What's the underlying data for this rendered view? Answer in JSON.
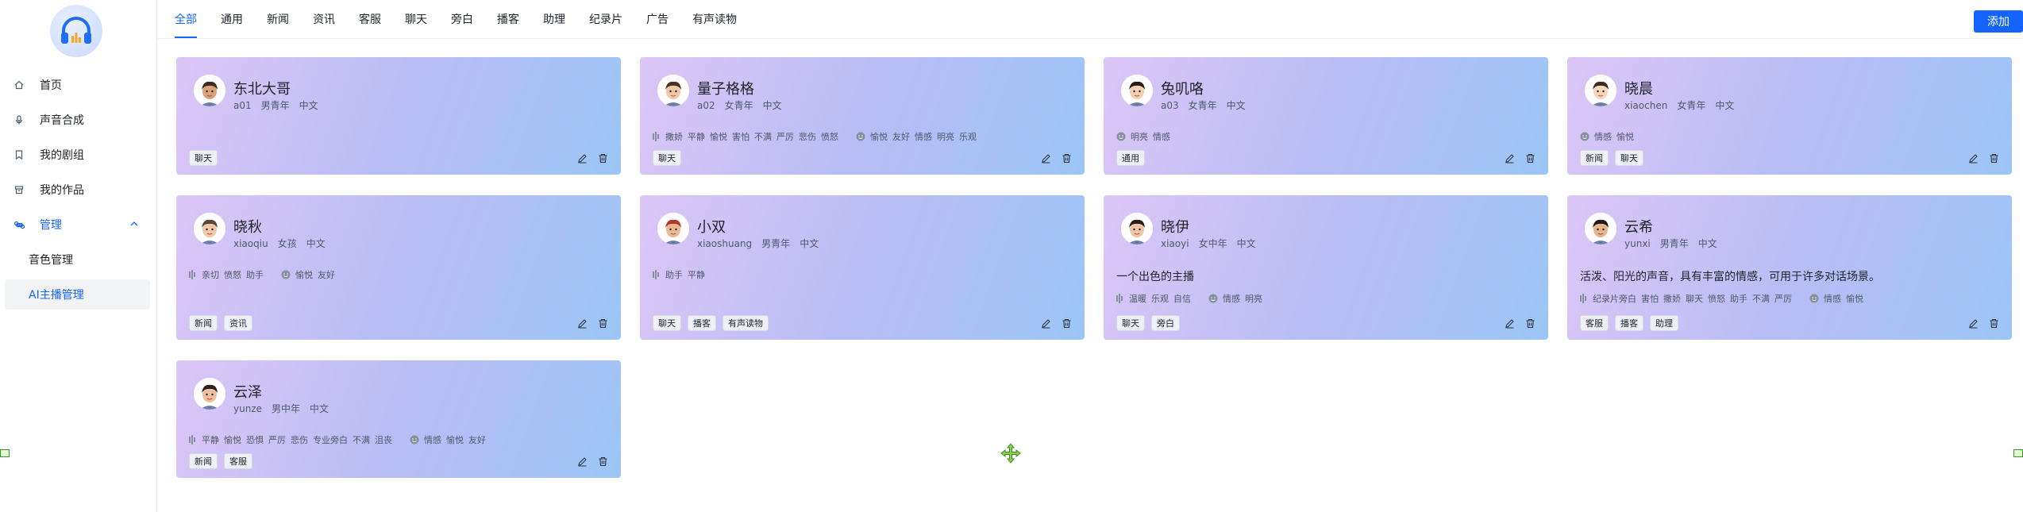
{
  "sidebar": {
    "items": [
      {
        "label": "首页",
        "icon": "home-icon"
      },
      {
        "label": "声音合成",
        "icon": "mic-icon"
      },
      {
        "label": "我的剧组",
        "icon": "bookmark-icon"
      },
      {
        "label": "我的作品",
        "icon": "box-icon"
      },
      {
        "label": "管理",
        "icon": "command-icon"
      },
      {
        "label": "音色管理"
      },
      {
        "label": "AI主播管理"
      }
    ]
  },
  "tabs": [
    "全部",
    "通用",
    "新闻",
    "资讯",
    "客服",
    "聊天",
    "旁白",
    "播客",
    "助理",
    "纪录片",
    "广告",
    "有声读物"
  ],
  "add_label": "添加",
  "colors": {
    "accent": "#1664ff"
  },
  "cards": [
    {
      "name": "东北大哥",
      "id": "a01",
      "gender": "男青年",
      "lang": "中文",
      "desc": "",
      "styles": [],
      "emotions": [],
      "tags": [
        "聊天"
      ]
    },
    {
      "name": "量子格格",
      "id": "a02",
      "gender": "女青年",
      "lang": "中文",
      "desc": "",
      "styles": [
        "撒娇",
        "平静",
        "愉悦",
        "害怕",
        "不满",
        "严厉",
        "悲伤",
        "愤怒"
      ],
      "emotions": [
        "愉悦",
        "友好",
        "情感",
        "明亮",
        "乐观"
      ],
      "tags": [
        "聊天"
      ]
    },
    {
      "name": "兔叽咯",
      "id": "a03",
      "gender": "女青年",
      "lang": "中文",
      "desc": "",
      "styles": [],
      "emotions": [
        "明亮",
        "情感"
      ],
      "tags": [
        "通用"
      ]
    },
    {
      "name": "晓晨",
      "id": "xiaochen",
      "gender": "女青年",
      "lang": "中文",
      "desc": "",
      "styles": [],
      "emotions": [
        "情感",
        "愉悦"
      ],
      "tags": [
        "新闻",
        "聊天"
      ]
    },
    {
      "name": "晓秋",
      "id": "xiaoqiu",
      "gender": "女孩",
      "lang": "中文",
      "desc": "",
      "styles": [
        "亲切",
        "愤怒",
        "助手"
      ],
      "emotions": [
        "愉悦",
        "友好"
      ],
      "tags": [
        "新闻",
        "资讯"
      ]
    },
    {
      "name": "小双",
      "id": "xiaoshuang",
      "gender": "男青年",
      "lang": "中文",
      "desc": "",
      "styles": [
        "助手",
        "平静"
      ],
      "emotions": [],
      "tags": [
        "聊天",
        "播客",
        "有声读物"
      ]
    },
    {
      "name": "晓伊",
      "id": "xiaoyi",
      "gender": "女中年",
      "lang": "中文",
      "desc": "一个出色的主播",
      "styles": [
        "温暖",
        "乐观",
        "自信"
      ],
      "emotions": [
        "情感",
        "明亮"
      ],
      "tags": [
        "聊天",
        "旁白"
      ]
    },
    {
      "name": "云希",
      "id": "yunxi",
      "gender": "男青年",
      "lang": "中文",
      "desc": "活泼、阳光的声音，具有丰富的情感，可用于许多对话场景。",
      "styles": [
        "纪录片旁白",
        "害怕",
        "撒娇",
        "聊天",
        "愤怒",
        "助手",
        "不满",
        "严厉"
      ],
      "emotions": [
        "情感",
        "愉悦"
      ],
      "tags": [
        "客服",
        "播客",
        "助理"
      ]
    },
    {
      "name": "云泽",
      "id": "yunze",
      "gender": "男中年",
      "lang": "中文",
      "desc": "",
      "styles": [
        "平静",
        "愉悦",
        "恐惧",
        "严厉",
        "悲伤",
        "专业旁白",
        "不满",
        "沮丧"
      ],
      "emotions": [
        "情感",
        "愉悦",
        "友好"
      ],
      "tags": [
        "新闻",
        "客服"
      ]
    }
  ]
}
